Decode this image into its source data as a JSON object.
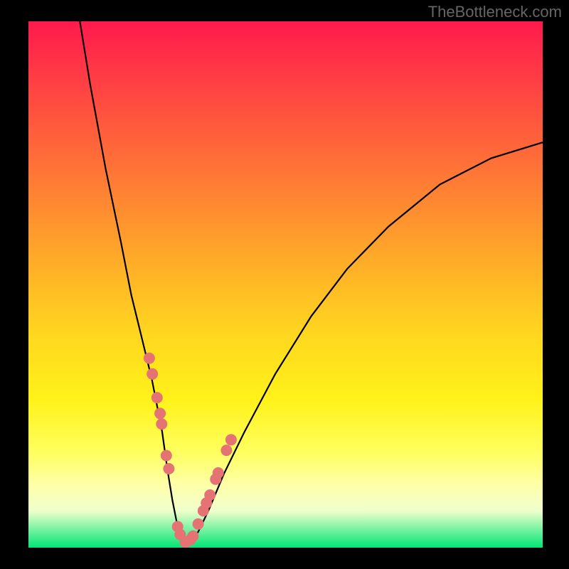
{
  "watermark": "TheBottleneck.com",
  "chart_data": {
    "type": "line",
    "title": "",
    "xlabel": "",
    "ylabel": "",
    "xlim": [
      0,
      100
    ],
    "ylim": [
      0,
      100
    ],
    "grid": false,
    "series": [
      {
        "name": "bottleneck-curve",
        "x": [
          10,
          12,
          15,
          18,
          20,
          22,
          24,
          26,
          27,
          28,
          29,
          30,
          31,
          33,
          35,
          38,
          42,
          48,
          55,
          62,
          70,
          80,
          90,
          100
        ],
        "y": [
          100,
          88,
          72,
          58,
          48,
          40,
          32,
          22,
          15,
          9,
          4,
          1,
          1,
          3,
          7,
          14,
          22,
          33,
          44,
          53,
          61,
          69,
          74,
          77
        ]
      }
    ],
    "markers": {
      "name": "highlight-points",
      "x": [
        23.5,
        24.1,
        25.0,
        25.6,
        25.9,
        26.8,
        27.3,
        29.0,
        29.5,
        30.5,
        31.5,
        32.0,
        33.0,
        34.0,
        34.6,
        35.3,
        36.4,
        36.9,
        38.5,
        39.4
      ],
      "y": [
        36.0,
        33.0,
        28.5,
        25.5,
        23.5,
        17.5,
        15.0,
        4.0,
        2.5,
        1.0,
        1.5,
        2.2,
        4.5,
        7.0,
        8.5,
        10.0,
        13.0,
        14.2,
        18.5,
        20.5
      ]
    },
    "colors": {
      "curve": "#000000",
      "marker": "#e57373",
      "gradient_top": "#ff1a4d",
      "gradient_bottom": "#00e676"
    }
  }
}
